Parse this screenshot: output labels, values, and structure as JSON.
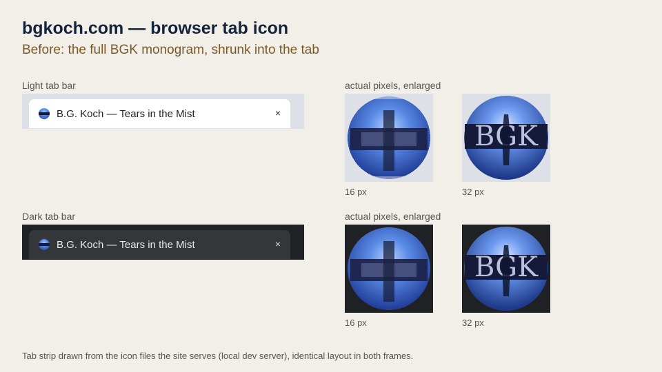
{
  "header": {
    "title": "bgkoch.com — browser tab icon",
    "subtitle": "Before: the full BGK monogram, shrunk into the tab"
  },
  "light_panel": {
    "label": "Light tab bar",
    "tab_title": "B.G. Koch — Tears in the Mist",
    "close_glyph": "×",
    "zoom_label": "actual pixels, enlarged",
    "size_small": "16 px",
    "size_large": "32 px",
    "monogram": "BGK"
  },
  "dark_panel": {
    "label": "Dark tab bar",
    "tab_title": "B.G. Koch — Tears in the Mist",
    "close_glyph": "×",
    "zoom_label": "actual pixels, enlarged",
    "size_small": "16 px",
    "size_large": "32 px",
    "monogram": "BGK"
  },
  "footer": {
    "note": "Tab strip drawn from the icon files the site serves (local dev server), identical layout in both frames."
  },
  "colors": {
    "light_strip": "#dde0e6",
    "dark_strip": "#202124",
    "icon_blue": "#4d7fe0",
    "icon_band": "#15193a"
  },
  "icons": {
    "favicon": "bgk-monogram-icon",
    "close": "close-icon"
  }
}
